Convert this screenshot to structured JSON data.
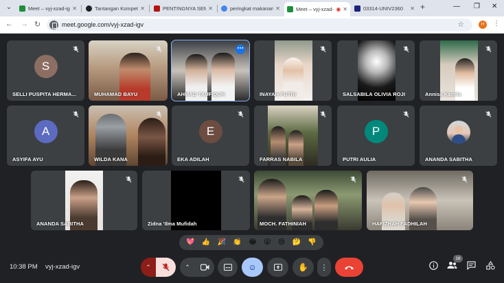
{
  "browser": {
    "tabs": [
      {
        "title": "Meet – vyj-xzad-igv",
        "color": "#1e8e3e"
      },
      {
        "title": "Tantangan Kompetisi",
        "color": "#202124"
      },
      {
        "title": "PENTINGNYA SEMBARAN",
        "color": "#b31412"
      },
      {
        "title": "peringkat makanan",
        "color": "#4285f4"
      },
      {
        "title": "Meet – vyj-xzad-igv",
        "color": "#1e8e3e"
      },
      {
        "title": "03314-UNIV2360",
        "color": "#1a237e"
      }
    ],
    "address": {
      "url": "meet.google.com/vyj-xzad-igv"
    },
    "profile_initial": "H"
  },
  "participants": [
    {
      "name": "SELLI PUSPITA HERMA...",
      "initial": "S",
      "avatar_color": "#8d6e63"
    },
    {
      "name": "MUHAMAD BAYU"
    },
    {
      "name": "AHMAD TAUFIQUR"
    },
    {
      "name": "INAYAH PUTRI"
    },
    {
      "name": "SALSABILA OLIVIA ROJI"
    },
    {
      "name": "Annisa Kamila"
    },
    {
      "name": "ASYIFA AYU",
      "initial": "A",
      "avatar_color": "#5c6bc0"
    },
    {
      "name": "WILDA KANA"
    },
    {
      "name": "EKA ADILAH",
      "initial": "E",
      "avatar_color": "#6d4c41"
    },
    {
      "name": "FARRAS NABILA"
    },
    {
      "name": "PUTRI AULIA",
      "initial": "P",
      "avatar_color": "#00897b"
    },
    {
      "name": "ANANDA SABITHA"
    },
    {
      "name": "ANANDA SABITHA"
    },
    {
      "name": "Zidna 'Ilma Mufidah"
    },
    {
      "name": "MOCH. FATHINIAH"
    },
    {
      "name": "HAFIZHAH FADHILAH"
    }
  ],
  "reactions": [
    "💖",
    "👍",
    "🎉",
    "👏",
    "😂",
    "😮",
    "😢",
    "🤔",
    "👎"
  ],
  "footer": {
    "time": "10:38 PM",
    "meeting_code": "vyj-xzad-igv",
    "people_count": "16"
  }
}
